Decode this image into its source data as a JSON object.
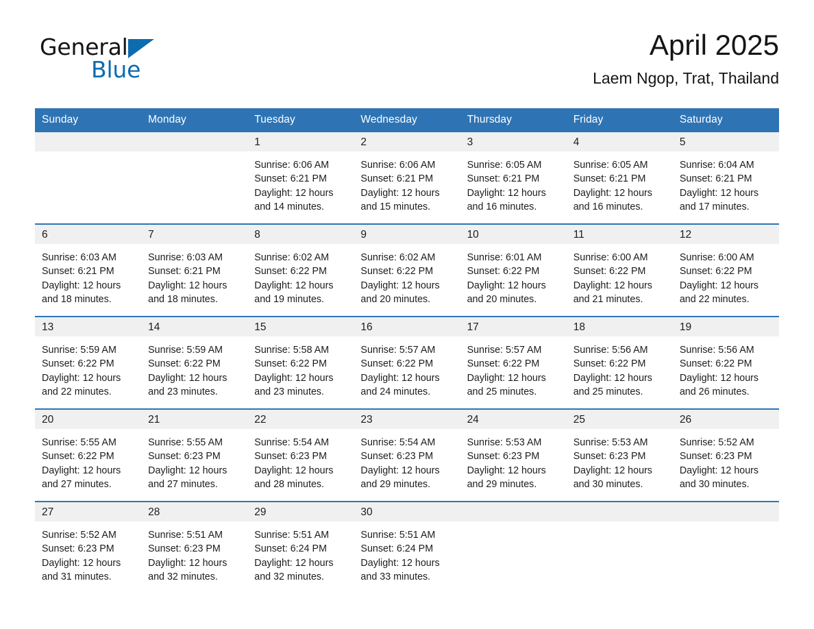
{
  "brand": {
    "line1": "General",
    "line2": "Blue",
    "triangle_color": "#0d6bb0"
  },
  "header": {
    "title": "April 2025",
    "subtitle": "Laem Ngop, Trat, Thailand"
  },
  "theme": {
    "header_blue": "#2e74b5",
    "row_divider_blue": "#2e74b5",
    "daynum_band": "#f0f0f0",
    "text": "#1c1c1c"
  },
  "calendar": {
    "weekday_headers": [
      "Sunday",
      "Monday",
      "Tuesday",
      "Wednesday",
      "Thursday",
      "Friday",
      "Saturday"
    ],
    "weeks": [
      [
        {
          "day": "",
          "sunrise": "",
          "sunset": "",
          "daylight_line1": "",
          "daylight_line2": "",
          "blank": true
        },
        {
          "day": "",
          "sunrise": "",
          "sunset": "",
          "daylight_line1": "",
          "daylight_line2": "",
          "blank": true
        },
        {
          "day": "1",
          "sunrise": "Sunrise: 6:06 AM",
          "sunset": "Sunset: 6:21 PM",
          "daylight_line1": "Daylight: 12 hours",
          "daylight_line2": "and 14 minutes.",
          "blank": false
        },
        {
          "day": "2",
          "sunrise": "Sunrise: 6:06 AM",
          "sunset": "Sunset: 6:21 PM",
          "daylight_line1": "Daylight: 12 hours",
          "daylight_line2": "and 15 minutes.",
          "blank": false
        },
        {
          "day": "3",
          "sunrise": "Sunrise: 6:05 AM",
          "sunset": "Sunset: 6:21 PM",
          "daylight_line1": "Daylight: 12 hours",
          "daylight_line2": "and 16 minutes.",
          "blank": false
        },
        {
          "day": "4",
          "sunrise": "Sunrise: 6:05 AM",
          "sunset": "Sunset: 6:21 PM",
          "daylight_line1": "Daylight: 12 hours",
          "daylight_line2": "and 16 minutes.",
          "blank": false
        },
        {
          "day": "5",
          "sunrise": "Sunrise: 6:04 AM",
          "sunset": "Sunset: 6:21 PM",
          "daylight_line1": "Daylight: 12 hours",
          "daylight_line2": "and 17 minutes.",
          "blank": false
        }
      ],
      [
        {
          "day": "6",
          "sunrise": "Sunrise: 6:03 AM",
          "sunset": "Sunset: 6:21 PM",
          "daylight_line1": "Daylight: 12 hours",
          "daylight_line2": "and 18 minutes.",
          "blank": false
        },
        {
          "day": "7",
          "sunrise": "Sunrise: 6:03 AM",
          "sunset": "Sunset: 6:21 PM",
          "daylight_line1": "Daylight: 12 hours",
          "daylight_line2": "and 18 minutes.",
          "blank": false
        },
        {
          "day": "8",
          "sunrise": "Sunrise: 6:02 AM",
          "sunset": "Sunset: 6:22 PM",
          "daylight_line1": "Daylight: 12 hours",
          "daylight_line2": "and 19 minutes.",
          "blank": false
        },
        {
          "day": "9",
          "sunrise": "Sunrise: 6:02 AM",
          "sunset": "Sunset: 6:22 PM",
          "daylight_line1": "Daylight: 12 hours",
          "daylight_line2": "and 20 minutes.",
          "blank": false
        },
        {
          "day": "10",
          "sunrise": "Sunrise: 6:01 AM",
          "sunset": "Sunset: 6:22 PM",
          "daylight_line1": "Daylight: 12 hours",
          "daylight_line2": "and 20 minutes.",
          "blank": false
        },
        {
          "day": "11",
          "sunrise": "Sunrise: 6:00 AM",
          "sunset": "Sunset: 6:22 PM",
          "daylight_line1": "Daylight: 12 hours",
          "daylight_line2": "and 21 minutes.",
          "blank": false
        },
        {
          "day": "12",
          "sunrise": "Sunrise: 6:00 AM",
          "sunset": "Sunset: 6:22 PM",
          "daylight_line1": "Daylight: 12 hours",
          "daylight_line2": "and 22 minutes.",
          "blank": false
        }
      ],
      [
        {
          "day": "13",
          "sunrise": "Sunrise: 5:59 AM",
          "sunset": "Sunset: 6:22 PM",
          "daylight_line1": "Daylight: 12 hours",
          "daylight_line2": "and 22 minutes.",
          "blank": false
        },
        {
          "day": "14",
          "sunrise": "Sunrise: 5:59 AM",
          "sunset": "Sunset: 6:22 PM",
          "daylight_line1": "Daylight: 12 hours",
          "daylight_line2": "and 23 minutes.",
          "blank": false
        },
        {
          "day": "15",
          "sunrise": "Sunrise: 5:58 AM",
          "sunset": "Sunset: 6:22 PM",
          "daylight_line1": "Daylight: 12 hours",
          "daylight_line2": "and 23 minutes.",
          "blank": false
        },
        {
          "day": "16",
          "sunrise": "Sunrise: 5:57 AM",
          "sunset": "Sunset: 6:22 PM",
          "daylight_line1": "Daylight: 12 hours",
          "daylight_line2": "and 24 minutes.",
          "blank": false
        },
        {
          "day": "17",
          "sunrise": "Sunrise: 5:57 AM",
          "sunset": "Sunset: 6:22 PM",
          "daylight_line1": "Daylight: 12 hours",
          "daylight_line2": "and 25 minutes.",
          "blank": false
        },
        {
          "day": "18",
          "sunrise": "Sunrise: 5:56 AM",
          "sunset": "Sunset: 6:22 PM",
          "daylight_line1": "Daylight: 12 hours",
          "daylight_line2": "and 25 minutes.",
          "blank": false
        },
        {
          "day": "19",
          "sunrise": "Sunrise: 5:56 AM",
          "sunset": "Sunset: 6:22 PM",
          "daylight_line1": "Daylight: 12 hours",
          "daylight_line2": "and 26 minutes.",
          "blank": false
        }
      ],
      [
        {
          "day": "20",
          "sunrise": "Sunrise: 5:55 AM",
          "sunset": "Sunset: 6:22 PM",
          "daylight_line1": "Daylight: 12 hours",
          "daylight_line2": "and 27 minutes.",
          "blank": false
        },
        {
          "day": "21",
          "sunrise": "Sunrise: 5:55 AM",
          "sunset": "Sunset: 6:23 PM",
          "daylight_line1": "Daylight: 12 hours",
          "daylight_line2": "and 27 minutes.",
          "blank": false
        },
        {
          "day": "22",
          "sunrise": "Sunrise: 5:54 AM",
          "sunset": "Sunset: 6:23 PM",
          "daylight_line1": "Daylight: 12 hours",
          "daylight_line2": "and 28 minutes.",
          "blank": false
        },
        {
          "day": "23",
          "sunrise": "Sunrise: 5:54 AM",
          "sunset": "Sunset: 6:23 PM",
          "daylight_line1": "Daylight: 12 hours",
          "daylight_line2": "and 29 minutes.",
          "blank": false
        },
        {
          "day": "24",
          "sunrise": "Sunrise: 5:53 AM",
          "sunset": "Sunset: 6:23 PM",
          "daylight_line1": "Daylight: 12 hours",
          "daylight_line2": "and 29 minutes.",
          "blank": false
        },
        {
          "day": "25",
          "sunrise": "Sunrise: 5:53 AM",
          "sunset": "Sunset: 6:23 PM",
          "daylight_line1": "Daylight: 12 hours",
          "daylight_line2": "and 30 minutes.",
          "blank": false
        },
        {
          "day": "26",
          "sunrise": "Sunrise: 5:52 AM",
          "sunset": "Sunset: 6:23 PM",
          "daylight_line1": "Daylight: 12 hours",
          "daylight_line2": "and 30 minutes.",
          "blank": false
        }
      ],
      [
        {
          "day": "27",
          "sunrise": "Sunrise: 5:52 AM",
          "sunset": "Sunset: 6:23 PM",
          "daylight_line1": "Daylight: 12 hours",
          "daylight_line2": "and 31 minutes.",
          "blank": false
        },
        {
          "day": "28",
          "sunrise": "Sunrise: 5:51 AM",
          "sunset": "Sunset: 6:23 PM",
          "daylight_line1": "Daylight: 12 hours",
          "daylight_line2": "and 32 minutes.",
          "blank": false
        },
        {
          "day": "29",
          "sunrise": "Sunrise: 5:51 AM",
          "sunset": "Sunset: 6:24 PM",
          "daylight_line1": "Daylight: 12 hours",
          "daylight_line2": "and 32 minutes.",
          "blank": false
        },
        {
          "day": "30",
          "sunrise": "Sunrise: 5:51 AM",
          "sunset": "Sunset: 6:24 PM",
          "daylight_line1": "Daylight: 12 hours",
          "daylight_line2": "and 33 minutes.",
          "blank": false
        },
        {
          "day": "",
          "sunrise": "",
          "sunset": "",
          "daylight_line1": "",
          "daylight_line2": "",
          "blank": true
        },
        {
          "day": "",
          "sunrise": "",
          "sunset": "",
          "daylight_line1": "",
          "daylight_line2": "",
          "blank": true
        },
        {
          "day": "",
          "sunrise": "",
          "sunset": "",
          "daylight_line1": "",
          "daylight_line2": "",
          "blank": true
        }
      ]
    ]
  }
}
